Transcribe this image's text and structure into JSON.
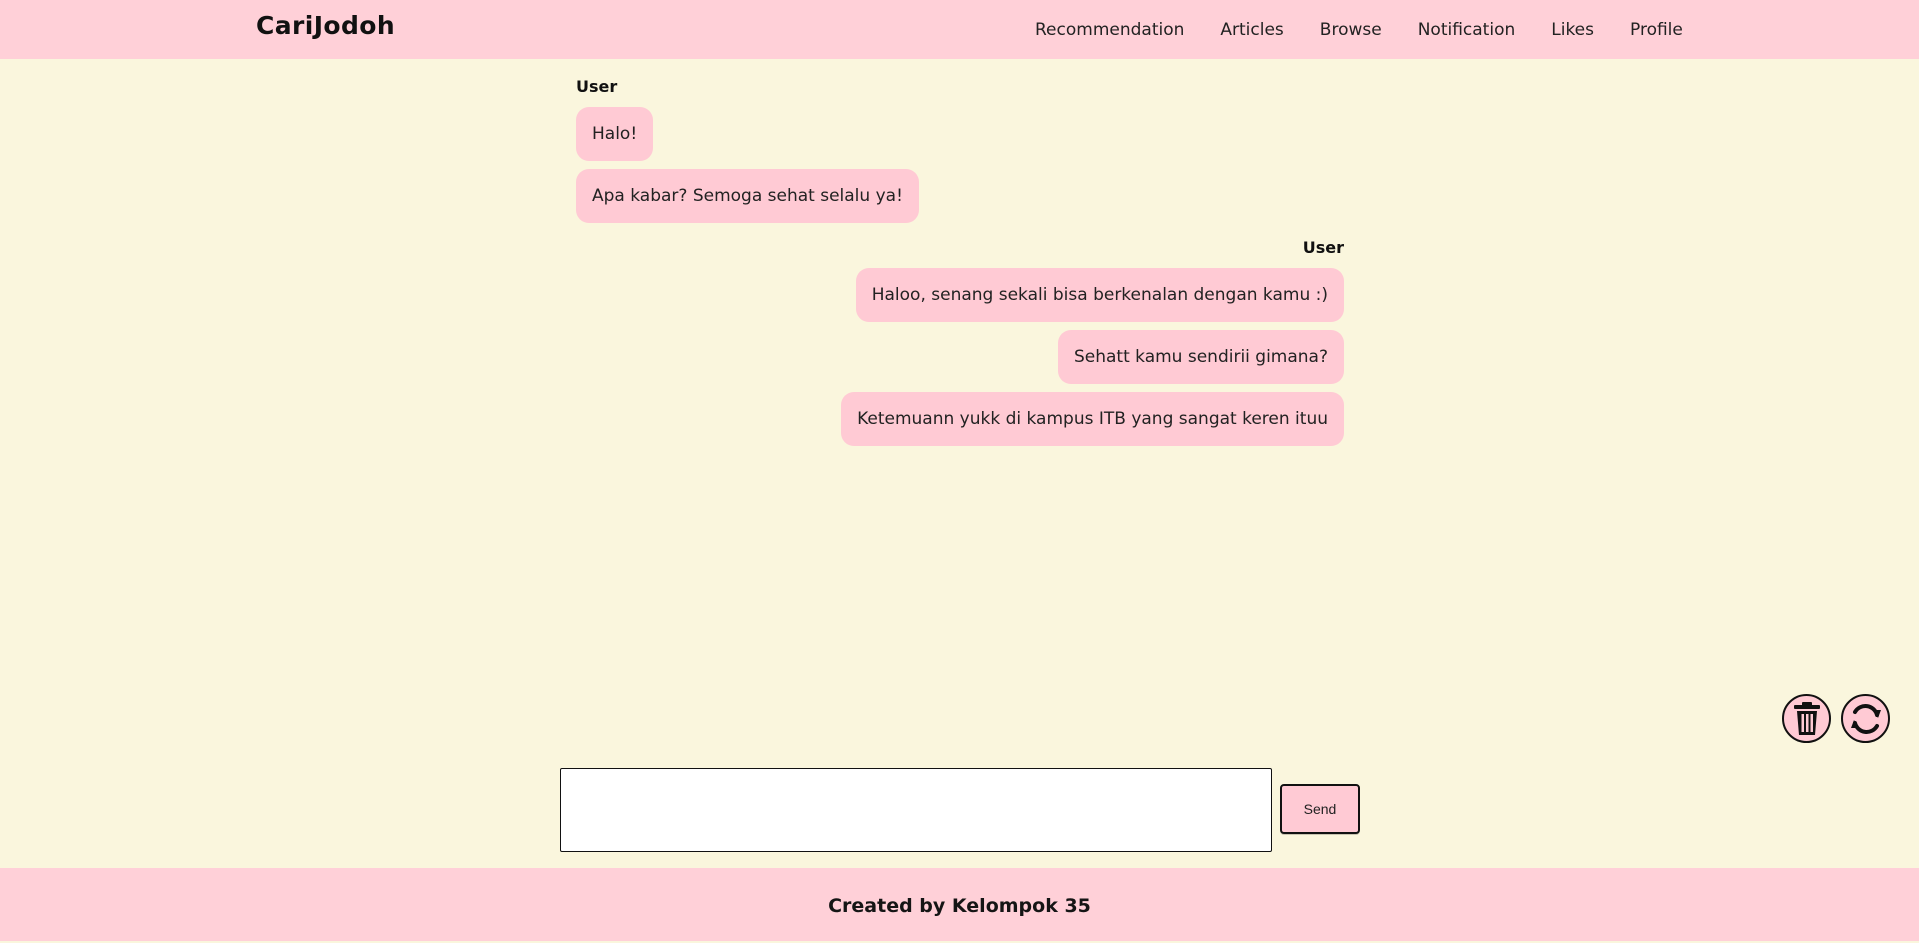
{
  "app": {
    "brand": "CariJodoh"
  },
  "nav": {
    "items": [
      {
        "label": "Recommendation"
      },
      {
        "label": "Articles"
      },
      {
        "label": "Browse"
      },
      {
        "label": "Notification"
      },
      {
        "label": "Likes"
      },
      {
        "label": "Profile"
      }
    ]
  },
  "chat": {
    "groups": [
      {
        "sender": "User",
        "side": "left",
        "messages": [
          "Halo!",
          "Apa kabar? Semoga sehat selalu ya!"
        ]
      },
      {
        "sender": "User",
        "side": "right",
        "messages": [
          "Haloo, senang sekali bisa berkenalan dengan kamu :)",
          "Sehatt kamu sendirii gimana?",
          "Ketemuann yukk di kampus ITB yang sangat keren ituu"
        ]
      }
    ]
  },
  "actions": {
    "delete_icon": "trash-icon",
    "refresh_icon": "refresh-icon"
  },
  "composer": {
    "value": "",
    "placeholder": "",
    "send_label": "Send"
  },
  "footer": {
    "text": "Created by Kelompok 35"
  },
  "colors": {
    "header": "#ffd0d8",
    "background": "#faf6dd",
    "bubble": "#ffcad4",
    "button": "#ffcad4"
  }
}
